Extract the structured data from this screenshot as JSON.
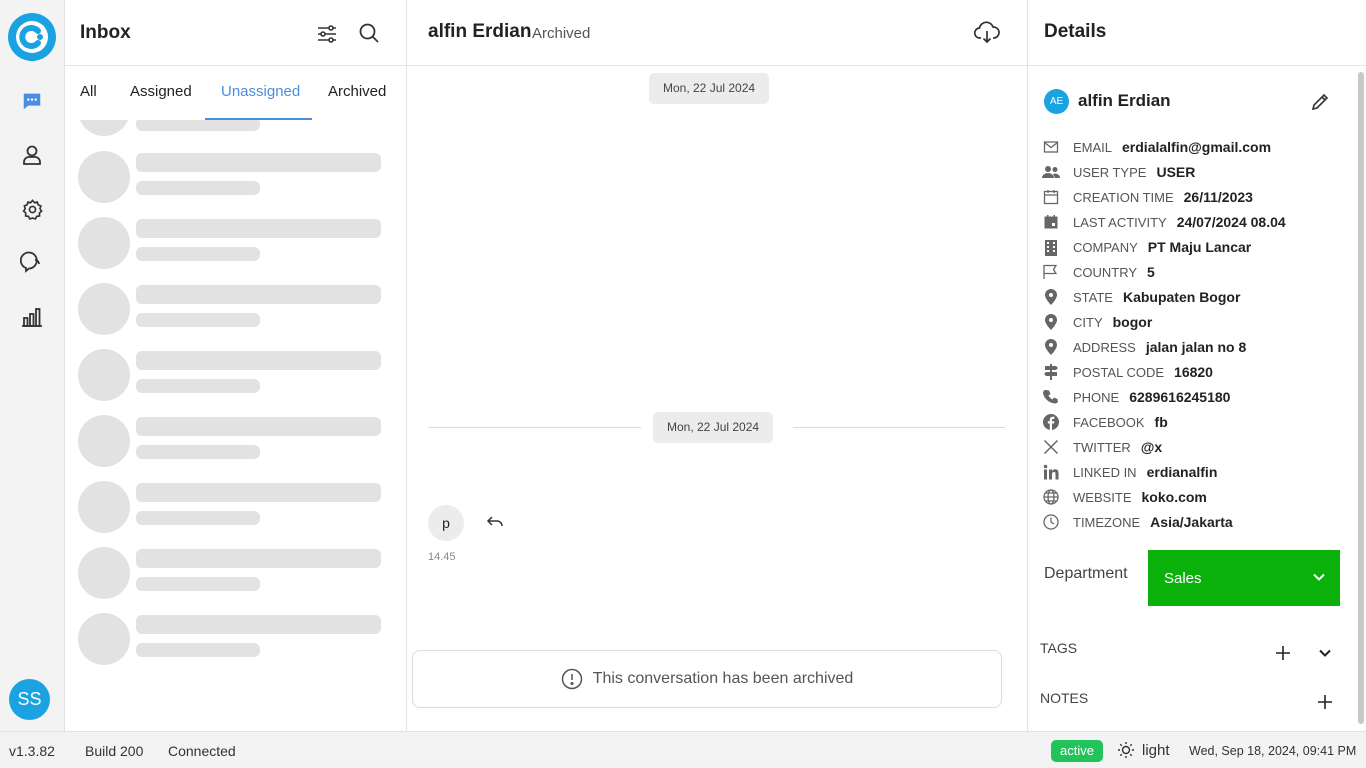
{
  "rail": {
    "items": [
      {
        "name": "chat-icon",
        "active": true
      },
      {
        "name": "user-icon",
        "active": false
      },
      {
        "name": "gear-icon",
        "active": false
      },
      {
        "name": "support-icon",
        "active": false
      },
      {
        "name": "analytics-icon",
        "active": false
      }
    ],
    "user_avatar": "SS",
    "accent": "#4a8ee0"
  },
  "inbox": {
    "title": "Inbox",
    "tabs": [
      "All",
      "Assigned",
      "Unassigned",
      "Archived"
    ],
    "active_tab": "Unassigned"
  },
  "chat": {
    "contact_name": "alfin Erdian",
    "status": "Archived",
    "date_top": "Mon, 22 Jul 2024",
    "date_mid": "Mon, 22 Jul 2024",
    "message": {
      "text": "p",
      "time": "14.45"
    },
    "archived_notice": "This conversation has been archived"
  },
  "details": {
    "title": "Details",
    "avatar": "AE",
    "name": "alfin Erdian",
    "fields": [
      {
        "icon": "mail-icon",
        "label": "EMAIL",
        "value": "erdialalfin@gmail.com"
      },
      {
        "icon": "users-icon",
        "label": "USER TYPE",
        "value": "USER"
      },
      {
        "icon": "calendar-icon",
        "label": "CREATION TIME",
        "value": "26/11/2023"
      },
      {
        "icon": "calendar-filled-icon",
        "label": "LAST ACTIVITY",
        "value": "24/07/2024 08.04"
      },
      {
        "icon": "building-icon",
        "label": "COMPANY",
        "value": "PT Maju Lancar"
      },
      {
        "icon": "flag-icon",
        "label": "COUNTRY",
        "value": "5"
      },
      {
        "icon": "pin-icon",
        "label": "STATE",
        "value": "Kabupaten Bogor"
      },
      {
        "icon": "pin-icon",
        "label": "CITY",
        "value": "bogor"
      },
      {
        "icon": "pin-icon",
        "label": "ADDRESS",
        "value": "jalan jalan no 8"
      },
      {
        "icon": "signpost-icon",
        "label": "POSTAL CODE",
        "value": "16820"
      },
      {
        "icon": "phone-icon",
        "label": "PHONE",
        "value": "6289616245180"
      },
      {
        "icon": "facebook-icon",
        "label": "FACEBOOK",
        "value": "fb"
      },
      {
        "icon": "x-twitter-icon",
        "label": "TWITTER",
        "value": "@x"
      },
      {
        "icon": "linkedin-icon",
        "label": "LINKED IN",
        "value": "erdianalfin"
      },
      {
        "icon": "globe-icon",
        "label": "WEBSITE",
        "value": "koko.com"
      },
      {
        "icon": "clock-icon",
        "label": "TIMEZONE",
        "value": "Asia/Jakarta"
      }
    ],
    "department_label": "Department",
    "department_value": "Sales",
    "department_color": "#0bb10b",
    "tags_label": "TAGS",
    "notes_label": "NOTES"
  },
  "statusbar": {
    "version": "v1.3.82",
    "build": "Build 200",
    "connection": "Connected",
    "badge": "active",
    "badge_color": "#22c35a",
    "theme": "light",
    "datetime": "Wed, Sep 18, 2024, 09:41 PM"
  }
}
